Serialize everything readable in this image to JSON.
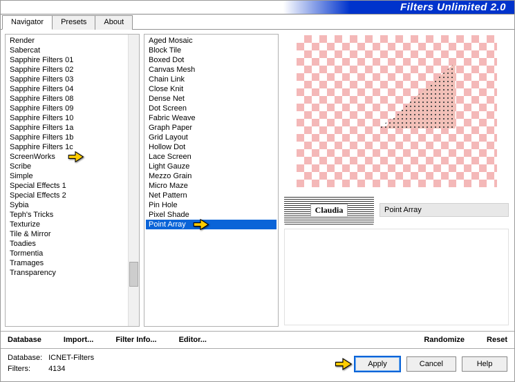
{
  "header": {
    "title": "Filters Unlimited 2.0"
  },
  "tabs": [
    {
      "label": "Navigator",
      "active": true
    },
    {
      "label": "Presets",
      "active": false
    },
    {
      "label": "About",
      "active": false
    }
  ],
  "categories": [
    "Render",
    "Sabercat",
    "Sapphire Filters 01",
    "Sapphire Filters 02",
    "Sapphire Filters 03",
    "Sapphire Filters 04",
    "Sapphire Filters 08",
    "Sapphire Filters 09",
    "Sapphire Filters 10",
    "Sapphire Filters 1a",
    "Sapphire Filters 1b",
    "Sapphire Filters 1c",
    "ScreenWorks",
    "Scribe",
    "Simple",
    "Special Effects 1",
    "Special Effects 2",
    "Sybia",
    "Teph's Tricks",
    "Texturize",
    "Tile & Mirror",
    "Toadies",
    "Tormentia",
    "Tramages",
    "Transparency"
  ],
  "category_marked": "ScreenWorks",
  "filters": [
    "Aged Mosaic",
    "Block Tile",
    "Boxed Dot",
    "Canvas Mesh",
    "Chain Link",
    "Close Knit",
    "Dense Net",
    "Dot Screen",
    "Fabric Weave",
    "Graph Paper",
    "Grid Layout",
    "Hollow Dot",
    "Lace Screen",
    "Light Gauze",
    "Mezzo Grain",
    "Micro Maze",
    "Net Pattern",
    "Pin Hole",
    "Pixel Shade",
    "Point Array"
  ],
  "filter_selected": "Point Array",
  "current_filter_name": "Point Array",
  "watermark": "Claudia",
  "toolbar": {
    "database": "Database",
    "import": "Import...",
    "filter_info": "Filter Info...",
    "editor": "Editor...",
    "randomize": "Randomize",
    "reset": "Reset"
  },
  "footer": {
    "db_label": "Database:",
    "db_value": "ICNET-Filters",
    "filters_label": "Filters:",
    "filters_value": "4134",
    "apply": "Apply",
    "cancel": "Cancel",
    "help": "Help"
  }
}
